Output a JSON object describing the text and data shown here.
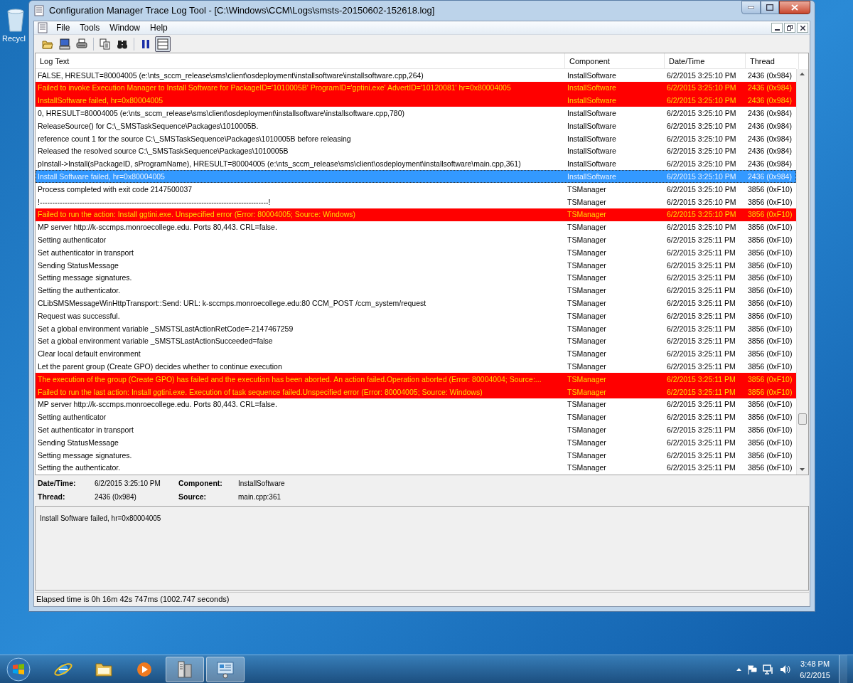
{
  "desktop": {
    "icon_label": "Recycl"
  },
  "window": {
    "title": "Configuration Manager Trace Log Tool - [C:\\Windows\\CCM\\Logs\\smsts-20150602-152618.log]"
  },
  "menu": [
    "File",
    "Tools",
    "Window",
    "Help"
  ],
  "toolbar": [
    {
      "kind": "open",
      "pressed": false
    },
    {
      "kind": "computer",
      "pressed": false
    },
    {
      "kind": "print",
      "pressed": false
    },
    {
      "kind": "copy",
      "pressed": false
    },
    {
      "kind": "find",
      "pressed": false
    },
    {
      "kind": "pause",
      "pressed": false
    },
    {
      "kind": "panel",
      "pressed": true
    }
  ],
  "table": {
    "columns": [
      "Log Text",
      "Component",
      "Date/Time",
      "Thread"
    ],
    "rows": [
      {
        "kind": "info",
        "selected": false,
        "cells": [
          "FALSE, HRESULT=80004005 (e:\\nts_sccm_release\\sms\\client\\osdeployment\\installsoftware\\installsoftware.cpp,264)",
          "InstallSoftware",
          "6/2/2015 3:25:10 PM",
          "2436 (0x984)"
        ]
      },
      {
        "kind": "error",
        "selected": false,
        "cells": [
          "Failed to invoke Execution Manager to Install Software for PackageID='1010005B' ProgramID='gptini.exe' AdvertID='10120081' hr=0x80004005",
          "InstallSoftware",
          "6/2/2015 3:25:10 PM",
          "2436 (0x984)"
        ]
      },
      {
        "kind": "error",
        "selected": false,
        "cells": [
          "InstallSoftware failed, hr=0x80004005",
          "InstallSoftware",
          "6/2/2015 3:25:10 PM",
          "2436 (0x984)"
        ]
      },
      {
        "kind": "info",
        "selected": false,
        "cells": [
          "0, HRESULT=80004005 (e:\\nts_sccm_release\\sms\\client\\osdeployment\\installsoftware\\installsoftware.cpp,780)",
          "InstallSoftware",
          "6/2/2015 3:25:10 PM",
          "2436 (0x984)"
        ]
      },
      {
        "kind": "info",
        "selected": false,
        "cells": [
          "ReleaseSource() for C:\\_SMSTaskSequence\\Packages\\1010005B.",
          "InstallSoftware",
          "6/2/2015 3:25:10 PM",
          "2436 (0x984)"
        ]
      },
      {
        "kind": "info",
        "selected": false,
        "cells": [
          "reference count 1 for the source C:\\_SMSTaskSequence\\Packages\\1010005B before releasing",
          "InstallSoftware",
          "6/2/2015 3:25:10 PM",
          "2436 (0x984)"
        ]
      },
      {
        "kind": "info",
        "selected": false,
        "cells": [
          "Released the resolved source C:\\_SMSTaskSequence\\Packages\\1010005B",
          "InstallSoftware",
          "6/2/2015 3:25:10 PM",
          "2436 (0x984)"
        ]
      },
      {
        "kind": "info",
        "selected": false,
        "cells": [
          "pInstall->Install(sPackageID, sProgramName), HRESULT=80004005 (e:\\nts_sccm_release\\sms\\client\\osdeployment\\installsoftware\\main.cpp,361)",
          "InstallSoftware",
          "6/2/2015 3:25:10 PM",
          "2436 (0x984)"
        ]
      },
      {
        "kind": "info",
        "selected": true,
        "cells": [
          "Install Software failed, hr=0x80004005",
          "InstallSoftware",
          "6/2/2015 3:25:10 PM",
          "2436 (0x984)"
        ]
      },
      {
        "kind": "info",
        "selected": false,
        "cells": [
          "Process completed with exit code 2147500037",
          "TSManager",
          "6/2/2015 3:25:10 PM",
          "3856 (0xF10)"
        ]
      },
      {
        "kind": "info",
        "selected": false,
        "cells": [
          "!--------------------------------------------------------------------------------------------!",
          "TSManager",
          "6/2/2015 3:25:10 PM",
          "3856 (0xF10)"
        ]
      },
      {
        "kind": "error",
        "selected": false,
        "cells": [
          "Failed to run the action: Install ggtini.exe. Unspecified error (Error: 80004005; Source: Windows)",
          "TSManager",
          "6/2/2015 3:25:10 PM",
          "3856 (0xF10)"
        ]
      },
      {
        "kind": "info",
        "selected": false,
        "cells": [
          "MP server http://k-sccmps.monroecollege.edu. Ports 80,443. CRL=false.",
          "TSManager",
          "6/2/2015 3:25:10 PM",
          "3856 (0xF10)"
        ]
      },
      {
        "kind": "info",
        "selected": false,
        "cells": [
          "Setting authenticator",
          "TSManager",
          "6/2/2015 3:25:11 PM",
          "3856 (0xF10)"
        ]
      },
      {
        "kind": "info",
        "selected": false,
        "cells": [
          "Set authenticator in transport",
          "TSManager",
          "6/2/2015 3:25:11 PM",
          "3856 (0xF10)"
        ]
      },
      {
        "kind": "info",
        "selected": false,
        "cells": [
          "Sending StatusMessage",
          "TSManager",
          "6/2/2015 3:25:11 PM",
          "3856 (0xF10)"
        ]
      },
      {
        "kind": "info",
        "selected": false,
        "cells": [
          "Setting message signatures.",
          "TSManager",
          "6/2/2015 3:25:11 PM",
          "3856 (0xF10)"
        ]
      },
      {
        "kind": "info",
        "selected": false,
        "cells": [
          "Setting the authenticator.",
          "TSManager",
          "6/2/2015 3:25:11 PM",
          "3856 (0xF10)"
        ]
      },
      {
        "kind": "info",
        "selected": false,
        "cells": [
          "CLibSMSMessageWinHttpTransport::Send: URL: k-sccmps.monroecollege.edu:80  CCM_POST /ccm_system/request",
          "TSManager",
          "6/2/2015 3:25:11 PM",
          "3856 (0xF10)"
        ]
      },
      {
        "kind": "info",
        "selected": false,
        "cells": [
          "Request was successful.",
          "TSManager",
          "6/2/2015 3:25:11 PM",
          "3856 (0xF10)"
        ]
      },
      {
        "kind": "info",
        "selected": false,
        "cells": [
          "Set a global environment variable _SMSTSLastActionRetCode=-2147467259",
          "TSManager",
          "6/2/2015 3:25:11 PM",
          "3856 (0xF10)"
        ]
      },
      {
        "kind": "info",
        "selected": false,
        "cells": [
          "Set a global environment variable _SMSTSLastActionSucceeded=false",
          "TSManager",
          "6/2/2015 3:25:11 PM",
          "3856 (0xF10)"
        ]
      },
      {
        "kind": "info",
        "selected": false,
        "cells": [
          "Clear local default environment",
          "TSManager",
          "6/2/2015 3:25:11 PM",
          "3856 (0xF10)"
        ]
      },
      {
        "kind": "info",
        "selected": false,
        "cells": [
          "Let the parent group (Create GPO) decides whether to continue execution",
          "TSManager",
          "6/2/2015 3:25:11 PM",
          "3856 (0xF10)"
        ]
      },
      {
        "kind": "error",
        "selected": false,
        "cells": [
          "The execution of the group (Create GPO) has failed and the execution has been aborted. An action failed.Operation aborted (Error: 80004004; Source:...",
          "TSManager",
          "6/2/2015 3:25:11 PM",
          "3856 (0xF10)"
        ]
      },
      {
        "kind": "error",
        "selected": false,
        "cells": [
          "Failed to run the last action: Install ggtini.exe. Execution of task sequence failed.Unspecified error (Error: 80004005; Source: Windows)",
          "TSManager",
          "6/2/2015 3:25:11 PM",
          "3856 (0xF10)"
        ]
      },
      {
        "kind": "info",
        "selected": false,
        "cells": [
          "MP server http://k-sccmps.monroecollege.edu. Ports 80,443. CRL=false.",
          "TSManager",
          "6/2/2015 3:25:11 PM",
          "3856 (0xF10)"
        ]
      },
      {
        "kind": "info",
        "selected": false,
        "cells": [
          "Setting authenticator",
          "TSManager",
          "6/2/2015 3:25:11 PM",
          "3856 (0xF10)"
        ]
      },
      {
        "kind": "info",
        "selected": false,
        "cells": [
          "Set authenticator in transport",
          "TSManager",
          "6/2/2015 3:25:11 PM",
          "3856 (0xF10)"
        ]
      },
      {
        "kind": "info",
        "selected": false,
        "cells": [
          "Sending StatusMessage",
          "TSManager",
          "6/2/2015 3:25:11 PM",
          "3856 (0xF10)"
        ]
      },
      {
        "kind": "info",
        "selected": false,
        "cells": [
          "Setting message signatures.",
          "TSManager",
          "6/2/2015 3:25:11 PM",
          "3856 (0xF10)"
        ]
      },
      {
        "kind": "info",
        "selected": false,
        "cells": [
          "Setting the authenticator.",
          "TSManager",
          "6/2/2015 3:25:11 PM",
          "3856 (0xF10)"
        ]
      }
    ]
  },
  "details": {
    "fields": [
      {
        "label": "Date/Time:",
        "value": "6/2/2015 3:25:10 PM"
      },
      {
        "label": "Component:",
        "value": "InstallSoftware"
      },
      {
        "label": "Thread:",
        "value": "2436 (0x984)"
      },
      {
        "label": "Source:",
        "value": "main.cpp:361"
      }
    ],
    "message": "Install Software failed, hr=0x80004005"
  },
  "status_bar": "Elapsed time is 0h 16m 42s 747ms (1002.747 seconds)",
  "taskbar": {
    "apps": [
      {
        "kind": "browser",
        "active": false
      },
      {
        "kind": "folder",
        "active": false
      },
      {
        "kind": "media",
        "active": false
      },
      {
        "kind": "server",
        "active": true
      },
      {
        "kind": "panel",
        "active": true
      }
    ],
    "clock": {
      "time": "3:48 PM",
      "date": "6/2/2015"
    }
  }
}
